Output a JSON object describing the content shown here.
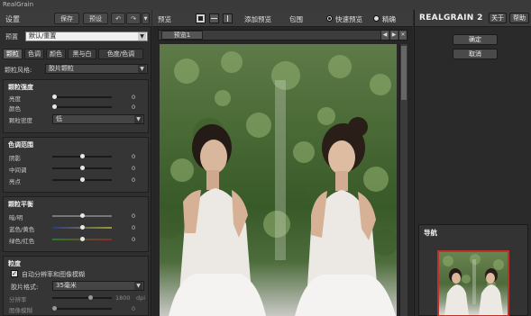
{
  "app": {
    "title": "RealGrain"
  },
  "left_panel": {
    "header": {
      "title": "设置",
      "save_label": "保存",
      "preset_label": "预设",
      "undo_icon": "undo-icon",
      "redo_icon": "redo-icon"
    },
    "preset": {
      "label": "预置",
      "value": "默认/重置"
    },
    "tabs": [
      {
        "label": "颗粒",
        "active": true
      },
      {
        "label": "色调",
        "active": false
      },
      {
        "label": "颜色",
        "active": false
      },
      {
        "label": "黑与白",
        "active": false
      },
      {
        "label": "色度/色调",
        "active": false
      }
    ],
    "grain_style": {
      "label": "颗粒风格:",
      "value": "胶片颗粒"
    },
    "grain_intensity": {
      "title": "颗粒强度",
      "rows": [
        {
          "label": "亮度",
          "value": "0",
          "pos": 0.02
        },
        {
          "label": "颜色",
          "value": "0",
          "pos": 0.02
        }
      ],
      "density": {
        "label": "颗粒密度",
        "value": "低"
      }
    },
    "tone_range": {
      "title": "色调范围",
      "rows": [
        {
          "label": "阴影",
          "value": "0",
          "pos": 0.5
        },
        {
          "label": "中间调",
          "value": "0",
          "pos": 0.5
        },
        {
          "label": "亮点",
          "value": "0",
          "pos": 0.5
        }
      ]
    },
    "grain_balance": {
      "title": "颗粒平衡",
      "rows": [
        {
          "label": "暗/明",
          "value": "0",
          "pos": 0.5,
          "color": "#888888"
        },
        {
          "label": "蓝色/黄色",
          "value": "0",
          "pos": 0.5,
          "color": "#6a6a3a"
        },
        {
          "label": "绿色/红色",
          "value": "0",
          "pos": 0.5,
          "color": "#3a6a3a"
        }
      ]
    },
    "grain_size": {
      "title": "粒度",
      "auto_checkbox": {
        "label": "自动分辨率和图像模糊",
        "checked": true
      },
      "film_format": {
        "label": "胶片格式:",
        "value": "35毫米"
      },
      "resolution": {
        "label": "分辨率",
        "value": "1800",
        "unit": "dpi"
      },
      "image_blur": {
        "label": "图像模糊",
        "value": "0"
      }
    }
  },
  "center_panel": {
    "preview_label": "预览",
    "add_preview": "添加预览",
    "wrap_label": "包围",
    "fast_preview": "快速预览",
    "precise": "精确",
    "preview_tab": "预览1"
  },
  "right_panel": {
    "logo": "REALGRAIN 2",
    "about": "关于",
    "help": "帮助",
    "ok": "确定",
    "cancel": "取消",
    "navigation": "导航"
  },
  "colors": {
    "accent_red": "#c0302a",
    "panel_bg": "#2e2e2e",
    "header_bg": "#3c3c3c"
  }
}
